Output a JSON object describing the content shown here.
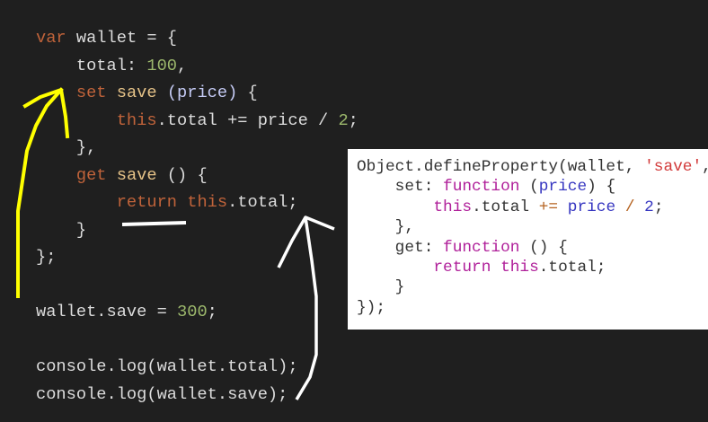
{
  "editor": {
    "lines": [
      [
        [
          "var",
          "kw"
        ],
        [
          " wallet = {",
          "id"
        ]
      ],
      [
        [
          "    total: ",
          "id"
        ],
        [
          "100",
          "num"
        ],
        [
          ",",
          "id"
        ]
      ],
      [
        [
          "    ",
          "id"
        ],
        [
          "set",
          "kw"
        ],
        [
          " ",
          "id"
        ],
        [
          "save",
          "fn"
        ],
        [
          " ",
          "id"
        ],
        [
          "(price)",
          "param"
        ],
        [
          " {",
          "id"
        ]
      ],
      [
        [
          "        ",
          "id"
        ],
        [
          "this",
          "this"
        ],
        [
          ".total += price / ",
          "id"
        ],
        [
          "2",
          "num"
        ],
        [
          ";",
          "id"
        ]
      ],
      [
        [
          "    },",
          "id"
        ]
      ],
      [
        [
          "    ",
          "id"
        ],
        [
          "get",
          "kw"
        ],
        [
          " ",
          "id"
        ],
        [
          "save",
          "fn"
        ],
        [
          " () {",
          "id"
        ]
      ],
      [
        [
          "        ",
          "id"
        ],
        [
          "return",
          "kw"
        ],
        [
          " ",
          "id"
        ],
        [
          "this",
          "this"
        ],
        [
          ".total;",
          "id"
        ]
      ],
      [
        [
          "    }",
          "id"
        ]
      ],
      [
        [
          "};",
          "id"
        ]
      ],
      [
        [
          "",
          "id"
        ]
      ],
      [
        [
          "wallet.save = ",
          "id"
        ],
        [
          "300",
          "num"
        ],
        [
          ";",
          "id"
        ]
      ],
      [
        [
          "",
          "id"
        ]
      ],
      [
        [
          "console.log(wallet.total);",
          "id"
        ]
      ],
      [
        [
          "console.log(wallet.save);",
          "id"
        ]
      ]
    ]
  },
  "snippet": {
    "lines": [
      [
        [
          "Object.defineProperty(wallet, ",
          "r-id"
        ],
        [
          "'save'",
          "r-str"
        ],
        [
          ",",
          "r-id"
        ]
      ],
      [
        [
          "    set: ",
          "r-id"
        ],
        [
          "function",
          "r-kw"
        ],
        [
          " (",
          "r-id"
        ],
        [
          "price",
          "r-param"
        ],
        [
          ") {",
          "r-id"
        ]
      ],
      [
        [
          "        ",
          "r-id"
        ],
        [
          "this",
          "r-kw"
        ],
        [
          ".total ",
          "r-id"
        ],
        [
          "+=",
          "r-op"
        ],
        [
          " ",
          "r-id"
        ],
        [
          "price",
          "r-param"
        ],
        [
          " ",
          "r-id"
        ],
        [
          "/",
          "r-op"
        ],
        [
          " ",
          "r-id"
        ],
        [
          "2",
          "r-num"
        ],
        [
          ";",
          "r-id"
        ]
      ],
      [
        [
          "    },",
          "r-id"
        ]
      ],
      [
        [
          "    get: ",
          "r-id"
        ],
        [
          "function",
          "r-kw"
        ],
        [
          " () {",
          "r-id"
        ]
      ],
      [
        [
          "        ",
          "r-id"
        ],
        [
          "return",
          "r-kw"
        ],
        [
          " ",
          "r-id"
        ],
        [
          "this",
          "r-kw"
        ],
        [
          ".total;",
          "r-id"
        ]
      ],
      [
        [
          "    }",
          "r-id"
        ]
      ],
      [
        [
          "});",
          "r-id"
        ]
      ]
    ]
  },
  "annotations": {
    "yellow": "#ffff00",
    "white": "#ffffff"
  }
}
